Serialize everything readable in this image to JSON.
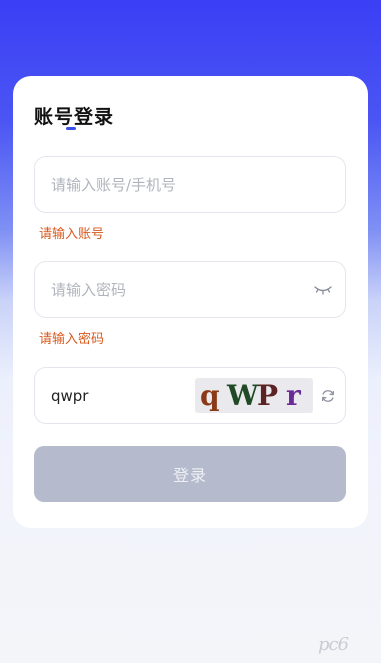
{
  "login": {
    "title": "账号登录",
    "account": {
      "placeholder": "请输入账号/手机号",
      "value": "",
      "error": "请输入账号"
    },
    "password": {
      "placeholder": "请输入密码",
      "value": "",
      "error": "请输入密码",
      "toggle_icon": "eye-closed-icon"
    },
    "captcha": {
      "value": "qwpr",
      "image_chars": [
        "q",
        "W",
        "P",
        "r"
      ],
      "refresh_icon": "refresh-icon"
    },
    "submit_label": "登录"
  },
  "watermark": {
    "text": "pc6"
  },
  "colors": {
    "accent": "#3a50e6",
    "error": "#d75a1f",
    "button_disabled": "#b5bbcd",
    "gradient_top": "#3b3ff5"
  }
}
